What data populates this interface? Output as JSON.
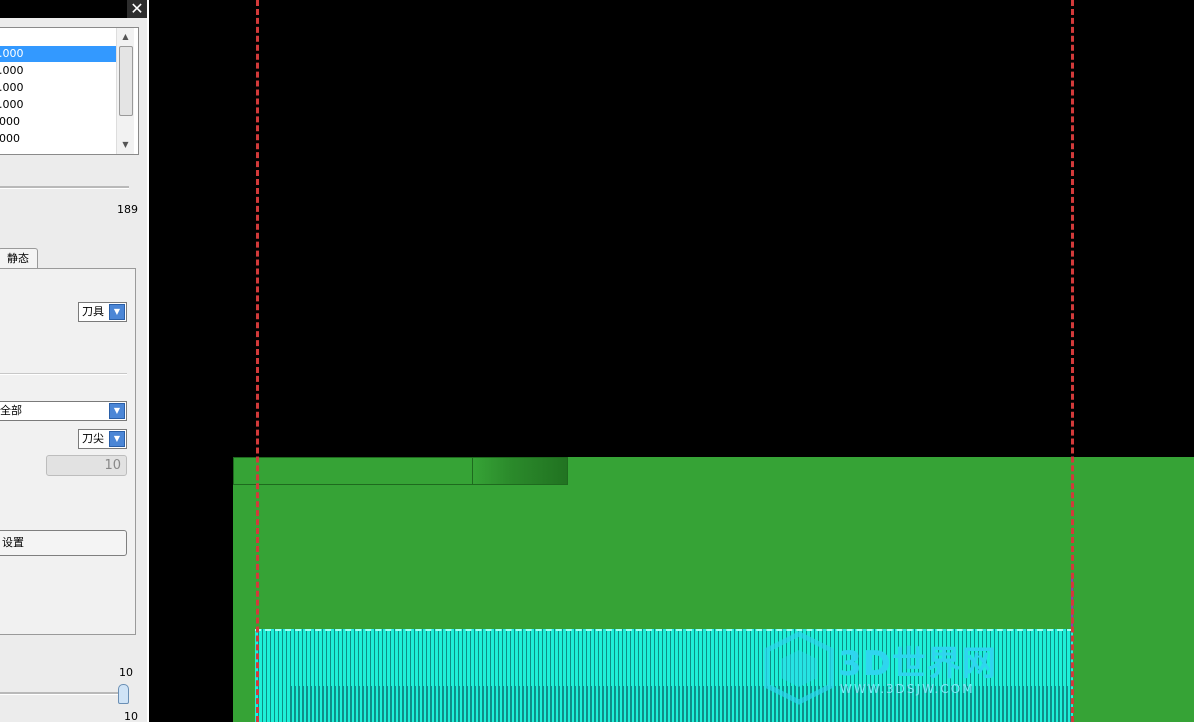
{
  "window": {
    "close_glyph": "✕"
  },
  "list": {
    "items": [
      ".000",
      ".000",
      ".000",
      ".000",
      "000",
      "000"
    ],
    "selected_index": 0
  },
  "slider": {
    "value": "189"
  },
  "tabs": {
    "active_label": "静态"
  },
  "dropdowns": {
    "tool": "刀具",
    "scope": "全部",
    "point": "刀尖"
  },
  "inputs": {
    "disabled_value": "10"
  },
  "buttons": {
    "settings_label": "设置"
  },
  "bottom_slider": {
    "max_label": "10",
    "value_label": "10"
  },
  "watermark": {
    "brand": "3D世界网",
    "url": "WWW.3DSJW.COM"
  },
  "colors": {
    "stock": "#36a336",
    "toolpath": "#1ef0d8",
    "boundary": "#d23a3a",
    "selection": "#3399ff"
  }
}
